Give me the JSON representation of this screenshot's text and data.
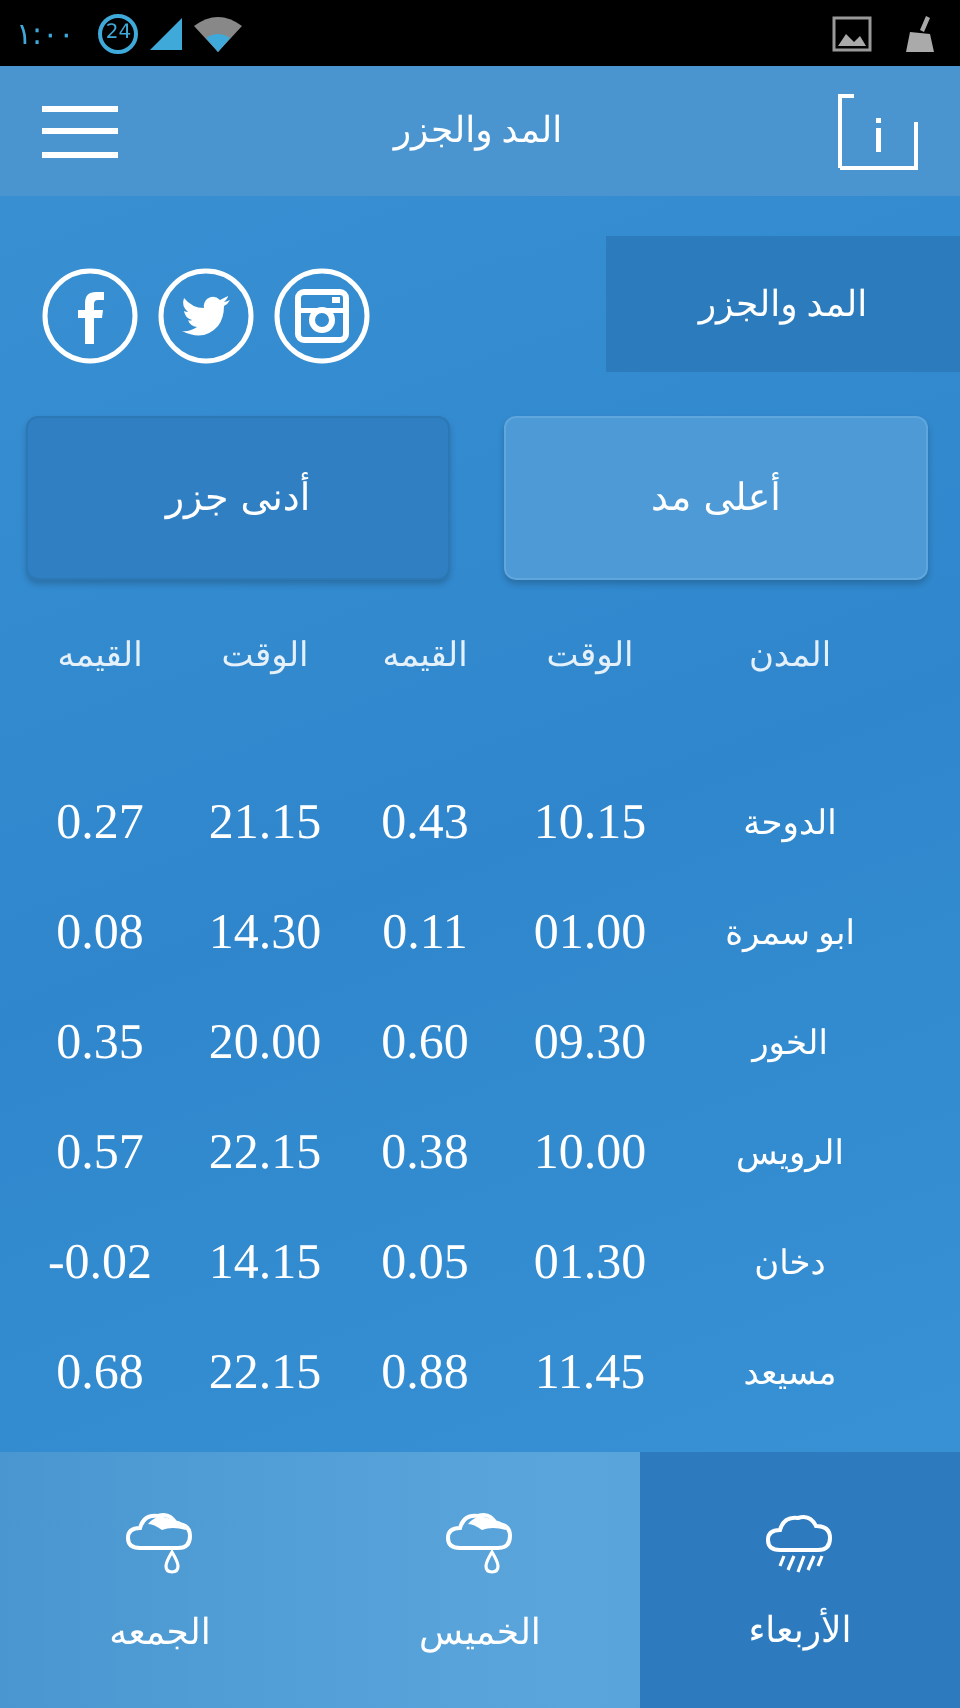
{
  "status_bar": {
    "time": "١:٠٠",
    "badge": "24"
  },
  "header": {
    "title": "المد والجزر"
  },
  "section_label": "المد والجزر",
  "tide_buttons": [
    {
      "label": "أعلى مد",
      "selected": true
    },
    {
      "label": "أدنى جزر",
      "selected": false
    }
  ],
  "table": {
    "columns": [
      "المدن",
      "الوقت",
      "القيمه",
      "الوقت",
      "القيمه"
    ],
    "rows": [
      [
        "الدوحة",
        "10.15",
        "0.43",
        "21.15",
        "0.27"
      ],
      [
        "ابو سمرة",
        "01.00",
        "0.11",
        "14.30",
        "0.08"
      ],
      [
        "الخور",
        "09.30",
        "0.60",
        "20.00",
        "0.35"
      ],
      [
        "الرويس",
        "10.00",
        "0.38",
        "22.15",
        "0.57"
      ],
      [
        "دخان",
        "01.30",
        "0.05",
        "14.15",
        "-0.02"
      ],
      [
        "مسيعد",
        "11.45",
        "0.88",
        "22.15",
        "0.68"
      ]
    ]
  },
  "days": [
    {
      "label": "الأربعاء",
      "kind": "rain",
      "selected": true
    },
    {
      "label": "الخميس",
      "kind": "drop",
      "selected": false
    },
    {
      "label": "الجمعه",
      "kind": "drop",
      "selected": false
    }
  ]
}
